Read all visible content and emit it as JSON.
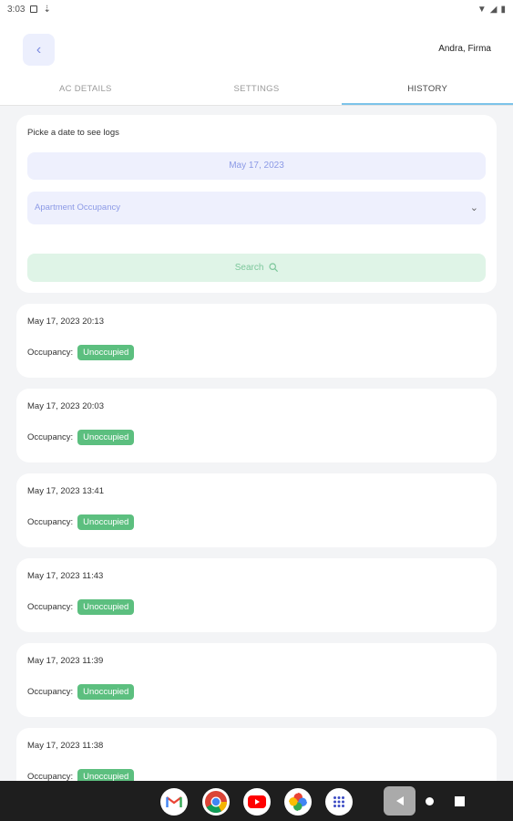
{
  "status_bar": {
    "time": "3:03"
  },
  "header": {
    "user_name": "Andra, Firma"
  },
  "tabs": [
    {
      "label": "AC DETAILS"
    },
    {
      "label": "SETTINGS"
    },
    {
      "label": "HISTORY",
      "active": true
    }
  ],
  "search": {
    "prompt": "Picke a date to see logs",
    "date_value": "May 17, 2023",
    "log_type": "Apartment Occupancy",
    "button_label": "Search"
  },
  "logs": [
    {
      "timestamp": "May 17, 2023 20:13",
      "label": "Occupancy:",
      "status": "Unoccupied"
    },
    {
      "timestamp": "May 17, 2023 20:03",
      "label": "Occupancy:",
      "status": "Unoccupied"
    },
    {
      "timestamp": "May 17, 2023 13:41",
      "label": "Occupancy:",
      "status": "Unoccupied"
    },
    {
      "timestamp": "May 17, 2023 11:43",
      "label": "Occupancy:",
      "status": "Unoccupied"
    },
    {
      "timestamp": "May 17, 2023 11:39",
      "label": "Occupancy:",
      "status": "Unoccupied"
    },
    {
      "timestamp": "May 17, 2023 11:38",
      "label": "Occupancy:",
      "status": "Unoccupied"
    }
  ],
  "colors": {
    "accent": "#8c9ae6",
    "status_green": "#5cbf7f",
    "tab_underline": "#7cc3e9"
  },
  "nav_apps": [
    "gmail-icon",
    "chrome-icon",
    "youtube-icon",
    "photos-icon",
    "app-drawer-icon"
  ]
}
